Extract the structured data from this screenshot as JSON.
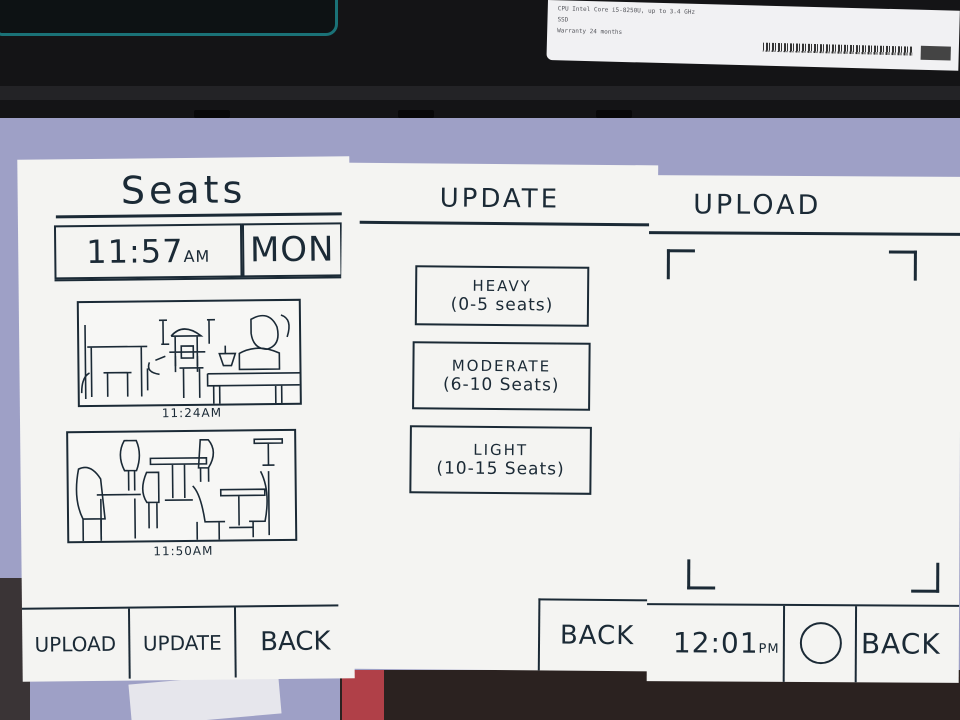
{
  "laptop_sticker": {
    "line1": "CPU  Intel Core i5-8250U, up to 3.4 GHz",
    "line2": "SSD",
    "line3": "Warranty 24 months"
  },
  "seats_screen": {
    "title": "Seats",
    "time": "11:57",
    "time_suffix": "AM",
    "day": "MON",
    "photos": [
      {
        "timestamp": "11:24AM"
      },
      {
        "timestamp": "11:50AM"
      }
    ],
    "nav": {
      "upload_label": "UPLOAD",
      "update_label": "UPDATE",
      "back_label": "BACK"
    }
  },
  "update_screen": {
    "title": "UPDATE",
    "options": [
      {
        "level": "HEAVY",
        "range": "(0-5 seats)"
      },
      {
        "level": "MODERATE",
        "range": "(6-10 Seats)"
      },
      {
        "level": "LIGHT",
        "range": "(10-15 Seats)"
      }
    ],
    "back_label": "BACK"
  },
  "upload_screen": {
    "title": "UPLOAD",
    "time": "12:01",
    "time_suffix": "PM",
    "back_label": "BACK"
  }
}
